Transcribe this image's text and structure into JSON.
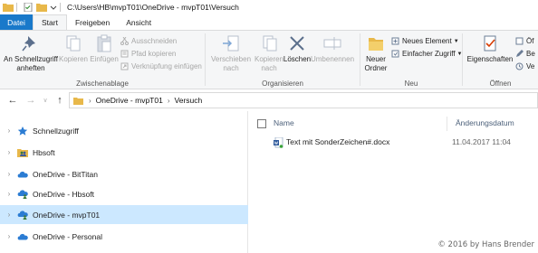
{
  "window": {
    "title": "C:\\Users\\HB\\mvpT01\\OneDrive - mvpT01\\Versuch"
  },
  "tabs": [
    {
      "label": "Datei"
    },
    {
      "label": "Start"
    },
    {
      "label": "Freigeben"
    },
    {
      "label": "Ansicht"
    }
  ],
  "ribbon": {
    "clipboard": {
      "pin_label_1": "An Schnellzugriff",
      "pin_label_2": "anheften",
      "copy_label": "Kopieren",
      "paste_label": "Einfügen",
      "cut_label": "Ausschneiden",
      "copy_path_label": "Pfad kopieren",
      "paste_shortcut_label": "Verknüpfung einfügen",
      "group_label": "Zwischenablage"
    },
    "organize": {
      "move_label_1": "Verschieben",
      "move_label_2": "nach",
      "copyto_label_1": "Kopieren",
      "copyto_label_2": "nach",
      "delete_label": "Löschen",
      "rename_label": "Umbenennen",
      "group_label": "Organisieren"
    },
    "new": {
      "newfolder_label_1": "Neuer",
      "newfolder_label_2": "Ordner",
      "newitem_label": "Neues Element",
      "easyaccess_label": "Einfacher Zugriff",
      "group_label": "Neu"
    },
    "open": {
      "properties_label": "Eigenschaften",
      "open_label": "Öf",
      "edit_label": "Be",
      "history_label": "Ve",
      "group_label": "Öffnen"
    }
  },
  "address": {
    "segments": [
      "OneDrive - mvpT01",
      "Versuch"
    ]
  },
  "nav": {
    "items": [
      {
        "label": "Schnellzugriff",
        "icon": "star-icon"
      },
      {
        "label": "Hbsoft",
        "icon": "people-folder-icon"
      },
      {
        "label": "OneDrive - BitTitan",
        "icon": "cloud-icon"
      },
      {
        "label": "OneDrive - Hbsoft",
        "icon": "cloud-people-icon"
      },
      {
        "label": "OneDrive - mvpT01",
        "icon": "cloud-people-icon"
      },
      {
        "label": "OneDrive - Personal",
        "icon": "cloud-icon"
      }
    ]
  },
  "content": {
    "columns": {
      "name": "Name",
      "date": "Änderungsdatum"
    },
    "files": [
      {
        "name": "Text mit SonderZeichen#.docx",
        "date": "11.04.2017 11:04",
        "icon": "word-document-icon"
      }
    ]
  },
  "watermark": "© 2016 by Hans Brender",
  "colors": {
    "file_tab": "#1979ca",
    "selected": "#cce8ff",
    "ribbon_bg": "#f5f6f7",
    "folder": "#e8b84a",
    "cloud": "#2b7cd3"
  }
}
